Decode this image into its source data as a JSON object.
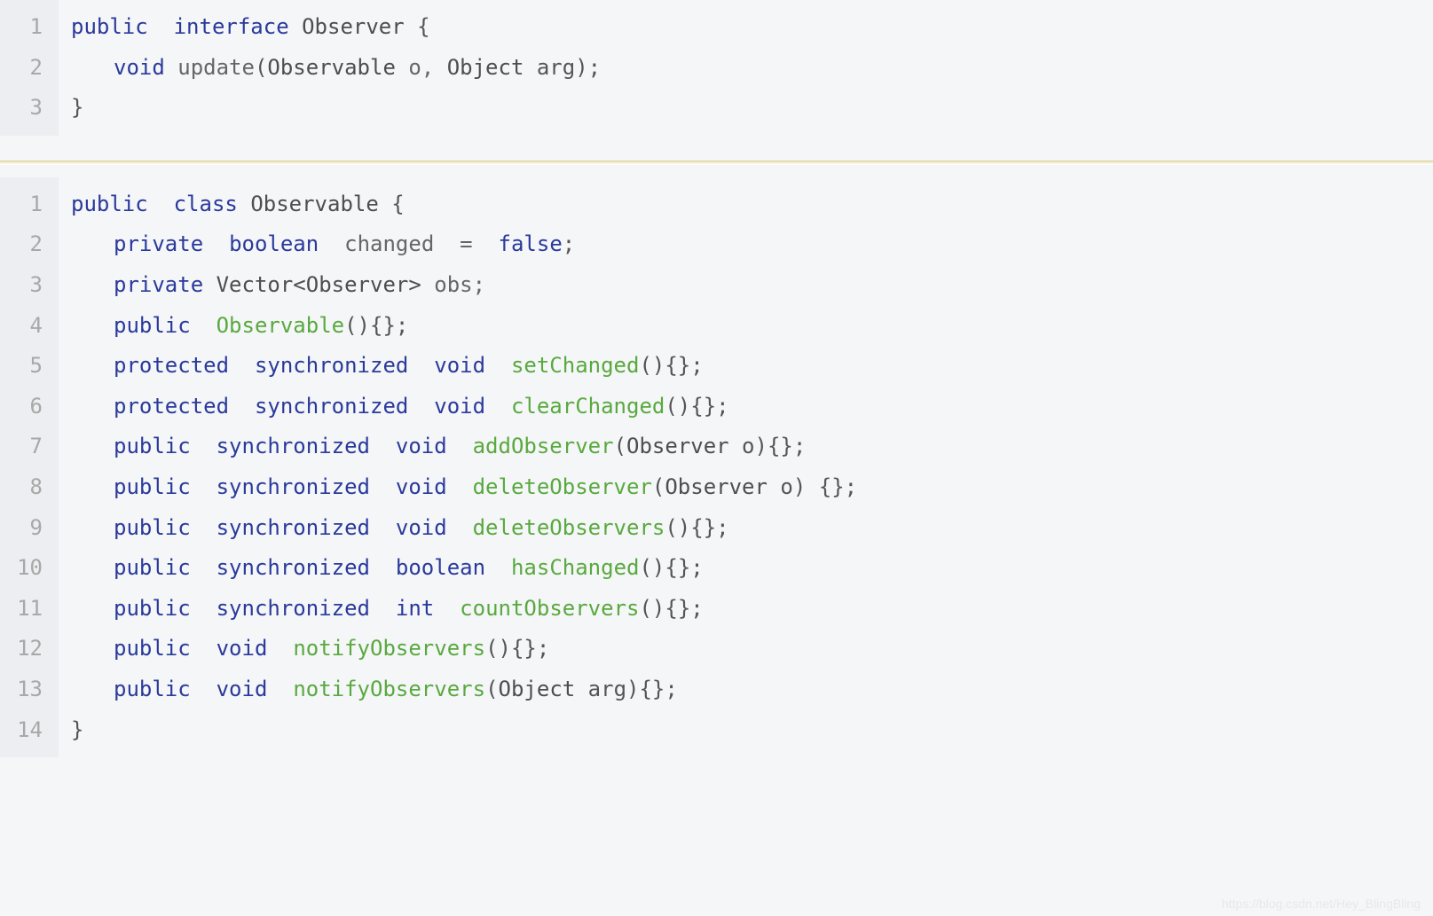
{
  "colors": {
    "keyword": "#2a3a9b",
    "function": "#59a93f",
    "text": "#555555",
    "gutter_bg": "#eceef1",
    "gutter_fg": "#a8a8a8",
    "page_bg": "#f5f6f8"
  },
  "watermark": "https://blog.csdn.net/Hey_BlingBling",
  "blocks": [
    {
      "id": "observer-interface",
      "line_numbers": [
        "1",
        "2",
        "3"
      ],
      "lines": [
        {
          "indent": 0,
          "tokens": [
            {
              "t": "public",
              "c": "kw"
            },
            {
              "t": "  ",
              "c": "sp"
            },
            {
              "t": "interface",
              "c": "kw"
            },
            {
              "t": " ",
              "c": "sp"
            },
            {
              "t": "Observer",
              "c": "type"
            },
            {
              "t": " {",
              "c": "punc"
            }
          ]
        },
        {
          "indent": 1,
          "tokens": [
            {
              "t": "void",
              "c": "kw"
            },
            {
              "t": " ",
              "c": "sp"
            },
            {
              "t": "update",
              "c": "ident"
            },
            {
              "t": "(",
              "c": "punc"
            },
            {
              "t": "Observable",
              "c": "type"
            },
            {
              "t": " o, ",
              "c": "ident"
            },
            {
              "t": "Object",
              "c": "type"
            },
            {
              "t": " arg);",
              "c": "punc"
            }
          ]
        },
        {
          "indent": 0,
          "tokens": [
            {
              "t": "}",
              "c": "punc"
            }
          ]
        }
      ]
    },
    {
      "id": "observable-class",
      "line_numbers": [
        "1",
        "2",
        "3",
        "4",
        "5",
        "6",
        "7",
        "8",
        "9",
        "10",
        "11",
        "12",
        "13",
        "14"
      ],
      "lines": [
        {
          "indent": 0,
          "tokens": [
            {
              "t": "public",
              "c": "kw"
            },
            {
              "t": "  ",
              "c": "sp"
            },
            {
              "t": "class",
              "c": "kw"
            },
            {
              "t": " ",
              "c": "sp"
            },
            {
              "t": "Observable",
              "c": "type"
            },
            {
              "t": " {",
              "c": "punc"
            }
          ]
        },
        {
          "indent": 1,
          "tokens": [
            {
              "t": "private",
              "c": "kw"
            },
            {
              "t": "  ",
              "c": "sp"
            },
            {
              "t": "boolean",
              "c": "kw"
            },
            {
              "t": "  ",
              "c": "sp"
            },
            {
              "t": "changed  =  ",
              "c": "ident"
            },
            {
              "t": "false",
              "c": "kw"
            },
            {
              "t": ";",
              "c": "punc"
            }
          ]
        },
        {
          "indent": 1,
          "tokens": [
            {
              "t": "private",
              "c": "kw"
            },
            {
              "t": " ",
              "c": "sp"
            },
            {
              "t": "Vector<Observer>",
              "c": "type"
            },
            {
              "t": " obs;",
              "c": "ident"
            }
          ]
        },
        {
          "indent": 1,
          "tokens": [
            {
              "t": "public",
              "c": "kw"
            },
            {
              "t": "  ",
              "c": "sp"
            },
            {
              "t": "Observable",
              "c": "fn"
            },
            {
              "t": "(){};",
              "c": "punc"
            }
          ]
        },
        {
          "indent": 1,
          "tokens": [
            {
              "t": "protected",
              "c": "kw"
            },
            {
              "t": "  ",
              "c": "sp"
            },
            {
              "t": "synchronized",
              "c": "kw"
            },
            {
              "t": "  ",
              "c": "sp"
            },
            {
              "t": "void",
              "c": "kw"
            },
            {
              "t": "  ",
              "c": "sp"
            },
            {
              "t": "setChanged",
              "c": "fn"
            },
            {
              "t": "(){};",
              "c": "punc"
            }
          ]
        },
        {
          "indent": 1,
          "tokens": [
            {
              "t": "protected",
              "c": "kw"
            },
            {
              "t": "  ",
              "c": "sp"
            },
            {
              "t": "synchronized",
              "c": "kw"
            },
            {
              "t": "  ",
              "c": "sp"
            },
            {
              "t": "void",
              "c": "kw"
            },
            {
              "t": "  ",
              "c": "sp"
            },
            {
              "t": "clearChanged",
              "c": "fn"
            },
            {
              "t": "(){};",
              "c": "punc"
            }
          ]
        },
        {
          "indent": 1,
          "tokens": [
            {
              "t": "public",
              "c": "kw"
            },
            {
              "t": "  ",
              "c": "sp"
            },
            {
              "t": "synchronized",
              "c": "kw"
            },
            {
              "t": "  ",
              "c": "sp"
            },
            {
              "t": "void",
              "c": "kw"
            },
            {
              "t": "  ",
              "c": "sp"
            },
            {
              "t": "addObserver",
              "c": "fn"
            },
            {
              "t": "(",
              "c": "punc"
            },
            {
              "t": "Observer",
              "c": "type"
            },
            {
              "t": " o){};",
              "c": "punc"
            }
          ]
        },
        {
          "indent": 1,
          "tokens": [
            {
              "t": "public",
              "c": "kw"
            },
            {
              "t": "  ",
              "c": "sp"
            },
            {
              "t": "synchronized",
              "c": "kw"
            },
            {
              "t": "  ",
              "c": "sp"
            },
            {
              "t": "void",
              "c": "kw"
            },
            {
              "t": "  ",
              "c": "sp"
            },
            {
              "t": "deleteObserver",
              "c": "fn"
            },
            {
              "t": "(",
              "c": "punc"
            },
            {
              "t": "Observer",
              "c": "type"
            },
            {
              "t": " o) {};",
              "c": "punc"
            }
          ]
        },
        {
          "indent": 1,
          "tokens": [
            {
              "t": "public",
              "c": "kw"
            },
            {
              "t": "  ",
              "c": "sp"
            },
            {
              "t": "synchronized",
              "c": "kw"
            },
            {
              "t": "  ",
              "c": "sp"
            },
            {
              "t": "void",
              "c": "kw"
            },
            {
              "t": "  ",
              "c": "sp"
            },
            {
              "t": "deleteObservers",
              "c": "fn"
            },
            {
              "t": "(){};",
              "c": "punc"
            }
          ]
        },
        {
          "indent": 1,
          "tokens": [
            {
              "t": "public",
              "c": "kw"
            },
            {
              "t": "  ",
              "c": "sp"
            },
            {
              "t": "synchronized",
              "c": "kw"
            },
            {
              "t": "  ",
              "c": "sp"
            },
            {
              "t": "boolean",
              "c": "kw"
            },
            {
              "t": "  ",
              "c": "sp"
            },
            {
              "t": "hasChanged",
              "c": "fn"
            },
            {
              "t": "(){};",
              "c": "punc"
            }
          ]
        },
        {
          "indent": 1,
          "tokens": [
            {
              "t": "public",
              "c": "kw"
            },
            {
              "t": "  ",
              "c": "sp"
            },
            {
              "t": "synchronized",
              "c": "kw"
            },
            {
              "t": "  ",
              "c": "sp"
            },
            {
              "t": "int",
              "c": "kw"
            },
            {
              "t": "  ",
              "c": "sp"
            },
            {
              "t": "countObservers",
              "c": "fn"
            },
            {
              "t": "(){};",
              "c": "punc"
            }
          ]
        },
        {
          "indent": 1,
          "tokens": [
            {
              "t": "public",
              "c": "kw"
            },
            {
              "t": "  ",
              "c": "sp"
            },
            {
              "t": "void",
              "c": "kw"
            },
            {
              "t": "  ",
              "c": "sp"
            },
            {
              "t": "notifyObservers",
              "c": "fn"
            },
            {
              "t": "(){};",
              "c": "punc"
            }
          ]
        },
        {
          "indent": 1,
          "tokens": [
            {
              "t": "public",
              "c": "kw"
            },
            {
              "t": "  ",
              "c": "sp"
            },
            {
              "t": "void",
              "c": "kw"
            },
            {
              "t": "  ",
              "c": "sp"
            },
            {
              "t": "notifyObservers",
              "c": "fn"
            },
            {
              "t": "(",
              "c": "punc"
            },
            {
              "t": "Object",
              "c": "type"
            },
            {
              "t": " arg){};",
              "c": "punc"
            }
          ]
        },
        {
          "indent": 0,
          "tokens": [
            {
              "t": "}",
              "c": "punc"
            }
          ]
        }
      ]
    }
  ]
}
